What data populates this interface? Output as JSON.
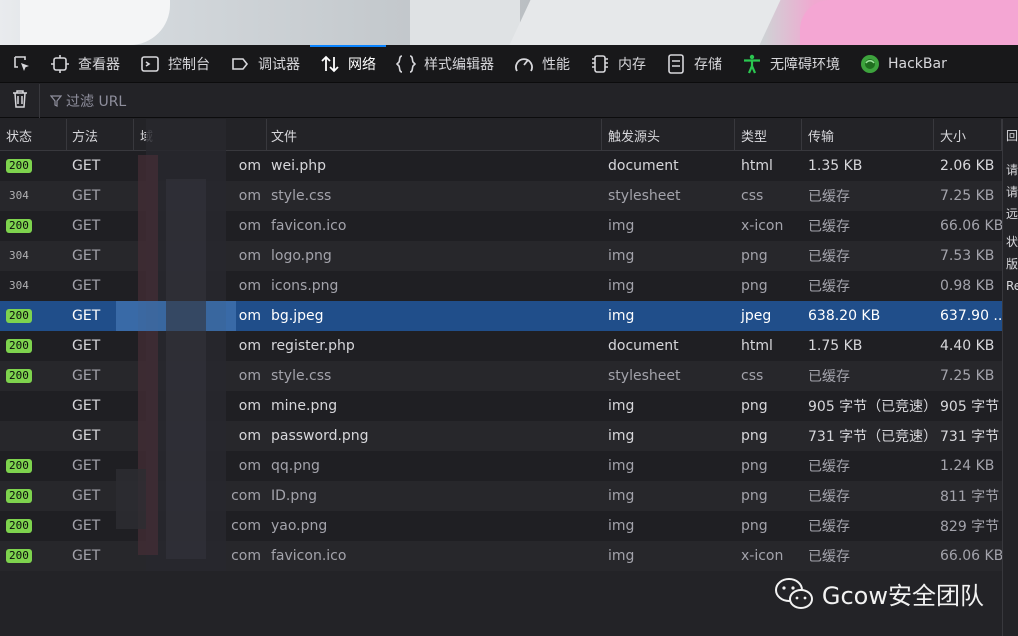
{
  "toolbar": {
    "tools": [
      {
        "label": "查看器",
        "icon": "inspector-icon"
      },
      {
        "label": "控制台",
        "icon": "console-icon"
      },
      {
        "label": "调试器",
        "icon": "debugger-icon"
      },
      {
        "label": "网络",
        "icon": "network-icon",
        "selected": true
      },
      {
        "label": "样式编辑器",
        "icon": "style-editor-icon"
      },
      {
        "label": "性能",
        "icon": "performance-icon"
      },
      {
        "label": "内存",
        "icon": "memory-icon"
      },
      {
        "label": "存储",
        "icon": "storage-icon"
      },
      {
        "label": "无障碍环境",
        "icon": "accessibility-icon"
      },
      {
        "label": "HackBar",
        "icon": "hackbar-icon"
      }
    ]
  },
  "filter": {
    "placeholder": "过滤 URL"
  },
  "columns": {
    "status": "状态",
    "method": "方法",
    "domain": "域",
    "file": "文件",
    "cause": "触发源头",
    "type": "类型",
    "transfer": "传输",
    "size": "大小"
  },
  "rows": [
    {
      "status": "200",
      "method": "GET",
      "domain": "om",
      "file": "wei.php",
      "cause": "document",
      "type": "html",
      "transfer": "1.35 KB",
      "size": "2.06 KB"
    },
    {
      "status": "304",
      "method": "GET",
      "domain": "om",
      "file": "style.css",
      "cause": "stylesheet",
      "type": "css",
      "transfer": "已缓存",
      "size": "7.25 KB"
    },
    {
      "status": "200",
      "method": "GET",
      "domain": "om",
      "file": "favicon.ico",
      "cause": "img",
      "type": "x-icon",
      "transfer": "已缓存",
      "size": "66.06 KB"
    },
    {
      "status": "304",
      "method": "GET",
      "domain": "om",
      "file": "logo.png",
      "cause": "img",
      "type": "png",
      "transfer": "已缓存",
      "size": "7.53 KB"
    },
    {
      "status": "304",
      "method": "GET",
      "domain": "om",
      "file": "icons.png",
      "cause": "img",
      "type": "png",
      "transfer": "已缓存",
      "size": "0.98 KB"
    },
    {
      "status": "200",
      "method": "GET",
      "domain": "om",
      "file": "bg.jpeg",
      "cause": "img",
      "type": "jpeg",
      "transfer": "638.20 KB",
      "size": "637.90 ...",
      "selected": true
    },
    {
      "status": "200",
      "method": "GET",
      "domain": "om",
      "file": "register.php",
      "cause": "document",
      "type": "html",
      "transfer": "1.75 KB",
      "size": "4.40 KB"
    },
    {
      "status": "200",
      "method": "GET",
      "domain": "om",
      "file": "style.css",
      "cause": "stylesheet",
      "type": "css",
      "transfer": "已缓存",
      "size": "7.25 KB"
    },
    {
      "status": "",
      "method": "GET",
      "domain": "om",
      "file": "mine.png",
      "cause": "img",
      "type": "png",
      "transfer": "905 字节（已竞速）",
      "size": "905 字节"
    },
    {
      "status": "",
      "method": "GET",
      "domain": "om",
      "file": "password.png",
      "cause": "img",
      "type": "png",
      "transfer": "731 字节（已竞速）",
      "size": "731 字节"
    },
    {
      "status": "200",
      "method": "GET",
      "domain": "om",
      "file": "qq.png",
      "cause": "img",
      "type": "png",
      "transfer": "已缓存",
      "size": "1.24 KB"
    },
    {
      "status": "200",
      "method": "GET",
      "domain": "com",
      "file": "ID.png",
      "cause": "img",
      "type": "png",
      "transfer": "已缓存",
      "size": "811 字节"
    },
    {
      "status": "200",
      "method": "GET",
      "domain": "com",
      "file": "yao.png",
      "cause": "img",
      "type": "png",
      "transfer": "已缓存",
      "size": "829 字节"
    },
    {
      "status": "200",
      "method": "GET",
      "domain": "com",
      "file": "favicon.ico",
      "cause": "img",
      "type": "x-icon",
      "transfer": "已缓存",
      "size": "66.06 KB"
    }
  ],
  "sidepanel": [
    "回",
    "请",
    "请",
    "远",
    "状",
    "版",
    "Re"
  ],
  "watermark": {
    "text": "Gcow安全团队",
    "icon": "wechat-icon"
  }
}
